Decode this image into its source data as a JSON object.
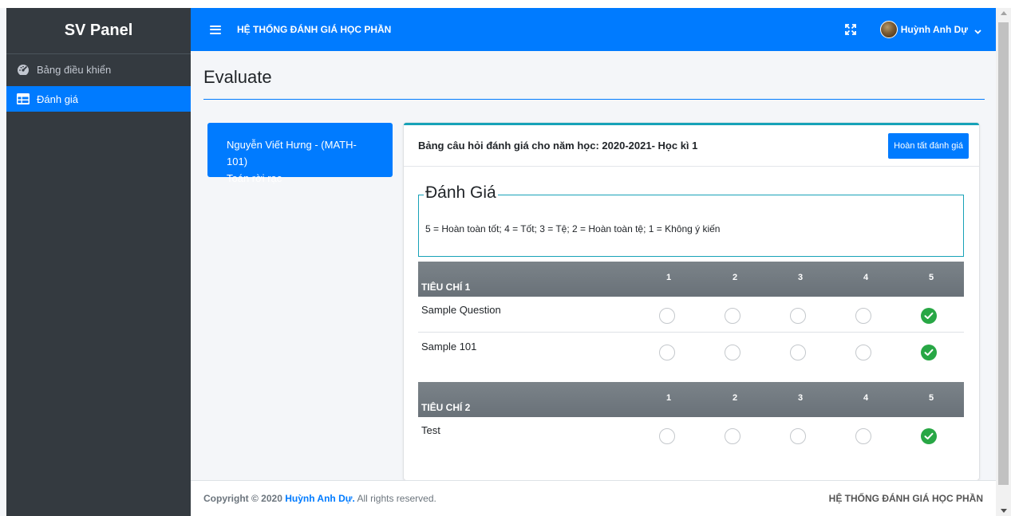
{
  "app": {
    "brand": "SV Panel",
    "system_title": "HỆ THỐNG ĐÁNH GIÁ HỌC PHẦN"
  },
  "sidebar": {
    "items": [
      {
        "label": "Bảng điều khiển",
        "icon": "dashboard-gauge-icon",
        "active": false
      },
      {
        "label": "Đánh giá",
        "icon": "table-icon",
        "active": true
      }
    ]
  },
  "header": {
    "user_name": "Huỳnh Anh Dự"
  },
  "page": {
    "title": "Evaluate"
  },
  "teacher_card": {
    "line1": "Nguyễn Viết Hưng - (MATH-101)",
    "line2": "Toán rời rạc"
  },
  "evaluation": {
    "heading": "Bảng câu hỏi đánh giá cho năm học: 2020-2021- Học kì 1",
    "finish_button": "Hoàn tất đánh giá",
    "legend_title": "Đánh Giá",
    "scale_text": "5 = Hoàn toàn tốt; 4 = Tốt; 3 = Tệ; 2 = Hoàn toàn tệ; 1 = Không ý kiến",
    "columns": [
      "1",
      "2",
      "3",
      "4",
      "5"
    ],
    "criteria": [
      {
        "name": "TIÊU CHÍ 1",
        "questions": [
          {
            "text": "Sample Question",
            "selected": 5
          },
          {
            "text": "Sample 101",
            "selected": 5
          }
        ]
      },
      {
        "name": "TIÊU CHÍ 2",
        "questions": [
          {
            "text": "Test",
            "selected": 5
          }
        ]
      }
    ]
  },
  "footer": {
    "copyright_prefix": "Copyright © 2020 ",
    "author": "Huỳnh Anh Dự.",
    "copyright_suffix": " All rights reserved.",
    "right_text": "HỆ THỐNG ĐÁNH GIÁ HỌC PHẦN"
  },
  "colors": {
    "primary": "#007bff",
    "sidebar_bg": "#343a40",
    "card_accent": "#17a2b8",
    "success": "#28a745",
    "criteria_header": "#6c757d"
  }
}
